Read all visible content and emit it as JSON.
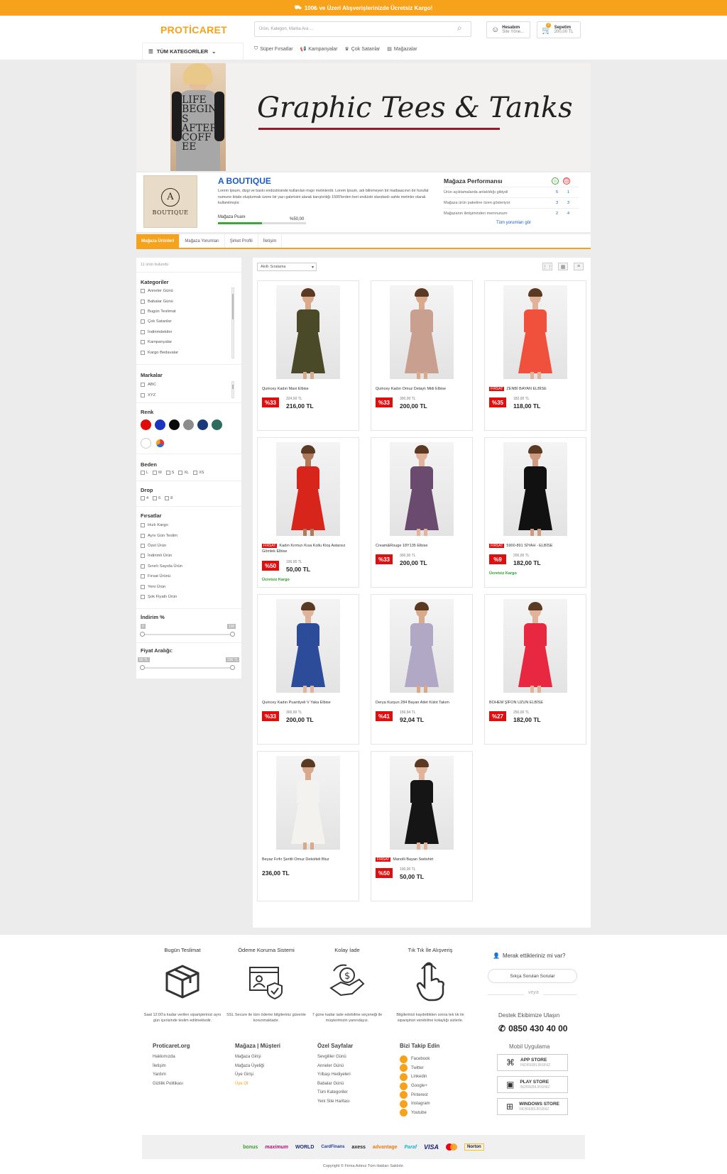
{
  "topbar": {
    "text": "100₺ ve Üzeri Alışverişlerinizde Ücretsiz Kargo!",
    "icon": "truck-icon"
  },
  "header": {
    "logo": "PROTİCARET",
    "search_placeholder": "Ürün, Kategori, Marka Ara ...",
    "account_label": "Hesabım",
    "account_sub": "Site Yöne...",
    "cart_label": "Sepetim",
    "cart_total": "200,00 TL",
    "cart_count": "2",
    "all_categories": "TÜM KATEGORİLER",
    "nav": [
      "Süper Fırsatlar",
      "Kampanyalar",
      "Çok Satanlar",
      "Mağazalar"
    ]
  },
  "banner": {
    "title": "Graphic Tees & Tanks",
    "shirt_text": "LIFE BEGINS AFTER COFFEE"
  },
  "store": {
    "name": "A BOUTIQUE",
    "logo_letter": "A",
    "logo_text": "BOUTIQUE",
    "description": "Lorem Ipsum, dizgi ve baskı endüstrisinde kullanılan mıgır metinlerdir. Lorem Ipsum, adı bilinmeyen bir matbaacının bir hurufat numune kitabı oluşturmak üzere bir yazı galerisini alarak karıştırdığı 1500'lerden beri endüstri standardı sahte metinler olarak kullanılmıştır.",
    "score_label": "Mağaza Puanı",
    "score_value": "%50,00",
    "score_fraction": 0.5
  },
  "performance": {
    "title": "Mağaza Performansı",
    "rows": [
      {
        "label": "Ürün açıklamalarda anlatıldığı gibiydi",
        "a": "5",
        "b": "1"
      },
      {
        "label": "Mağaza ürün paketine özen gösteriyor",
        "a": "3",
        "b": "3"
      },
      {
        "label": "Mağazanın iletişiminden memnunum",
        "a": "2",
        "b": "4"
      }
    ],
    "link": "Tüm yorumları gör"
  },
  "tabs": [
    "Mağaza Ürünleri",
    "Mağaza Yorumları",
    "Şirket Profili",
    "İletişim"
  ],
  "sidebar": {
    "count": "11 ürün bulundu",
    "categories_title": "Kategoriler",
    "categories": [
      "Anneler Günü",
      "Babalar Günü",
      "Bugün Teslimat",
      "Çok Satanlar",
      "İndirimdekiler",
      "Kampanyalar",
      "Kargo Bedavalar"
    ],
    "brands_title": "Markalar",
    "brands": [
      "ABC",
      "XYZ"
    ],
    "color_title": "Renk",
    "colors": [
      "#e30a0a",
      "#1b35c1",
      "#0a0a0a",
      "#8c8c8c",
      "#1a3a7a",
      "#2f6b5e",
      "#ffffff",
      "multi"
    ],
    "size_title": "Beden",
    "sizes": [
      "L",
      "M",
      "S",
      "XL",
      "XS"
    ],
    "drop_title": "Drop",
    "drops": [
      "4",
      "6",
      "8"
    ],
    "deals_title": "Fırsatlar",
    "deals": [
      "Hızlı Kargo",
      "Aynı Gün Teslim",
      "Özel Ürün",
      "İndirimli Ürün",
      "Sınırlı Sayıda Ürün",
      "Fırsat Ürünü",
      "Yeni Ürün",
      "Şok Fiyatlı Ürün"
    ],
    "discount_title": "İndirim %",
    "discount_min": "0",
    "discount_max": "100",
    "price_title": "Fiyat Aralığı:",
    "price_min": "50 TL",
    "price_max": "236 TL"
  },
  "products": {
    "sort": "Akıllı Sıralama",
    "items": [
      {
        "name": "Quincey Kadın Maxi Elbise",
        "flag": "",
        "badge": "%33",
        "old": "324,00 TL",
        "price": "216,00 TL",
        "cargo": "",
        "dress": "#4a4a28",
        "skin": "#d9a98c"
      },
      {
        "name": "Quincey Kadın Omuz Detaylı Midi Elbise",
        "flag": "",
        "badge": "%33",
        "old": "300,00 TL",
        "price": "200,00 TL",
        "cargo": "",
        "dress": "#c9a090",
        "skin": "#d9a98c"
      },
      {
        "name": "ZENBİ BAYAN ELBİSE",
        "flag": "FIRSAT",
        "badge": "%35",
        "old": "182,00 TL",
        "price": "118,00 TL",
        "cargo": "",
        "dress": "#f0513c",
        "skin": "#e0b39a"
      },
      {
        "name": "Kadın Kırmızı Kısa Kollu Kloş Astarsız Gömlek Elbise",
        "flag": "FIRSAT",
        "badge": "%50",
        "old": "100,00 TL",
        "price": "50,00 TL",
        "cargo": "Ücretsiz Kargo",
        "dress": "#d8251c",
        "skin": "#b07a5a"
      },
      {
        "name": "Cream&Rouge 18Y135 Elbise",
        "flag": "",
        "badge": "%33",
        "old": "300,00 TL",
        "price": "200,00 TL",
        "cargo": "",
        "dress": "#6a4a6e",
        "skin": "#e0b39a"
      },
      {
        "name": "5900-891 SİYAH - ELBİSE",
        "flag": "FIRSAT",
        "badge": "%9",
        "old": "200,00 TL",
        "price": "182,00 TL",
        "cargo": "Ücretsiz Kargo",
        "dress": "#111111",
        "skin": "#d09a80"
      },
      {
        "name": "Quincey Kadın Puantiyeli V Yaka Elbise",
        "flag": "",
        "badge": "%33",
        "old": "300,00 TL",
        "price": "200,00 TL",
        "cargo": "",
        "dress": "#2c4c9a",
        "skin": "#e0b39a"
      },
      {
        "name": "Derya Kurşun 284 Bayan Atlet Külot Takım",
        "flag": "",
        "badge": "%41",
        "old": "156,94 TL",
        "price": "92,04 TL",
        "cargo": "",
        "dress": "#b0a8c4",
        "skin": "#d9a98c"
      },
      {
        "name": "BOHEM ŞİFON UZUN ELBİSE",
        "flag": "",
        "badge": "%27",
        "old": "250,00 TL",
        "price": "182,00 TL",
        "cargo": "",
        "dress": "#e82840",
        "skin": "#e0b39a"
      },
      {
        "name": "Beyaz Fırfır Şeritli Omuz Dekolteli Bluz",
        "flag": "",
        "badge": "",
        "old": "",
        "price": "236,00 TL",
        "cargo": "",
        "dress": "#f4f2ee",
        "skin": "#d9a98c"
      },
      {
        "name": "Manolli Bayan Switshirt",
        "flag": "FIRSAT",
        "badge": "%50",
        "old": "100,00 TL",
        "price": "50,00 TL",
        "cargo": "",
        "dress": "#151515",
        "skin": "#e0b39a"
      }
    ]
  },
  "footer": {
    "features": [
      {
        "title": "Bugün Teslimat",
        "text": "Saat 12:00'a kadar verilen siparişlerinizi aynı gün içerisinde teslim edilmektedir."
      },
      {
        "title": "Ödeme Koruma Sistemi",
        "text": "SSL Secure ile tüm ödeme bilgileriniz güvenle korunmaktadır."
      },
      {
        "title": "Kolay İade",
        "text": "7 güne kadar iade edebilme seçeneği ile müşterimizin yanındayız."
      },
      {
        "title": "Tık Tık İle Alışveriş",
        "text": "Bilgilerinizi kaydettikten sonra tek tık ile siparişinizi verebilme kolaylığı sizlerle."
      }
    ],
    "question": "Merak ettikleriniz mi var?",
    "faq_button": "Sıkça Sorulan Sorular",
    "or": "veya",
    "support_title": "Destek Ekibimize Ulaşın",
    "phone": "0850 430 40 00",
    "cols": [
      {
        "title": "Proticaret.org",
        "links": [
          "Hakkımızda",
          "İletişim",
          "Yardım",
          "Gizlilik Politikası"
        ]
      },
      {
        "title": "Mağaza | Müşteri",
        "links": [
          "Mağaza Girişi",
          "Mağaza Üyeliği",
          "Üye Girişi",
          "Üye Ol"
        ]
      },
      {
        "title": "Özel Sayfalar",
        "links": [
          "Sevgililer Günü",
          "Anneler Günü",
          "Yılbaşı Hediyeleri",
          "Babalar Günü",
          "Tüm Kategoriler",
          "Yeni Site Haritası"
        ]
      }
    ],
    "social_title": "Bizi Takip Edin",
    "social": [
      "Facebook",
      "Twitter",
      "Linkedin",
      "Google+",
      "Pinterest",
      "Instagram",
      "Youtube"
    ],
    "app_title": "Mobil Uygulama",
    "apps": [
      {
        "name": "APP STORE",
        "sub": "İNDİREBİLİRSİNİZ"
      },
      {
        "name": "PLAY STORE",
        "sub": "İNDİREBİLİRSİNİZ"
      },
      {
        "name": "WINDOWS STORE",
        "sub": "İNDİREBİLİRSİNİZ"
      }
    ],
    "payments": [
      "bonus",
      "maximum",
      "WORLD",
      "CardFinans",
      "axess",
      "advantage",
      "Paraf",
      "VISA",
      "mastercard",
      "Norton"
    ],
    "copyright": "Copyright © Firma Adınız Tüm Hakları Saklıdır."
  }
}
